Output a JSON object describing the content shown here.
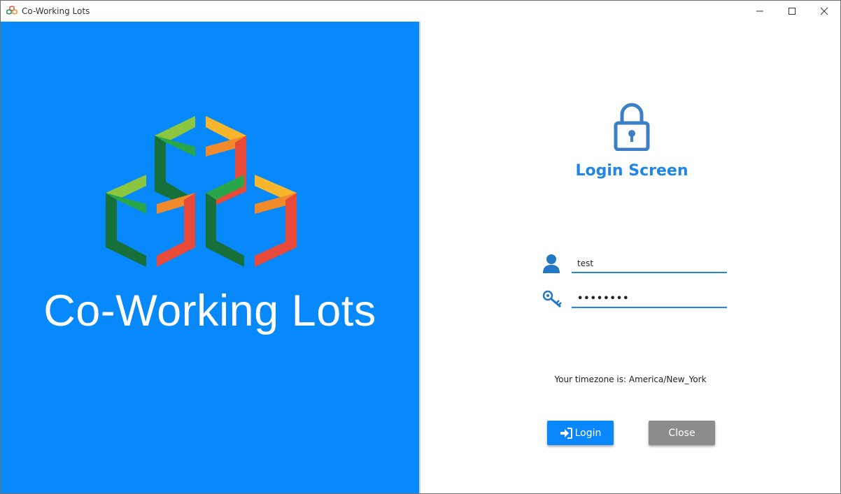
{
  "window": {
    "title": "Co-Working Lots",
    "controls": [
      "minimize-icon",
      "maximize-icon",
      "close-icon"
    ]
  },
  "brand": {
    "name": "Co-Working Lots",
    "background_color": "#0788fb",
    "logo_icon": "stacked-cubes-logo"
  },
  "login": {
    "lock_icon": "lock-icon",
    "title": "Login Screen",
    "username": {
      "icon": "user-icon",
      "value": "test"
    },
    "password": {
      "icon": "key-icon",
      "value": "••••••••"
    },
    "timezone_text": "Your timezone is: America/New_York",
    "login_button": {
      "icon": "sign-in-icon",
      "label": "Login"
    },
    "close_button": {
      "label": "Close"
    },
    "accent_color": "#1e86e6"
  }
}
